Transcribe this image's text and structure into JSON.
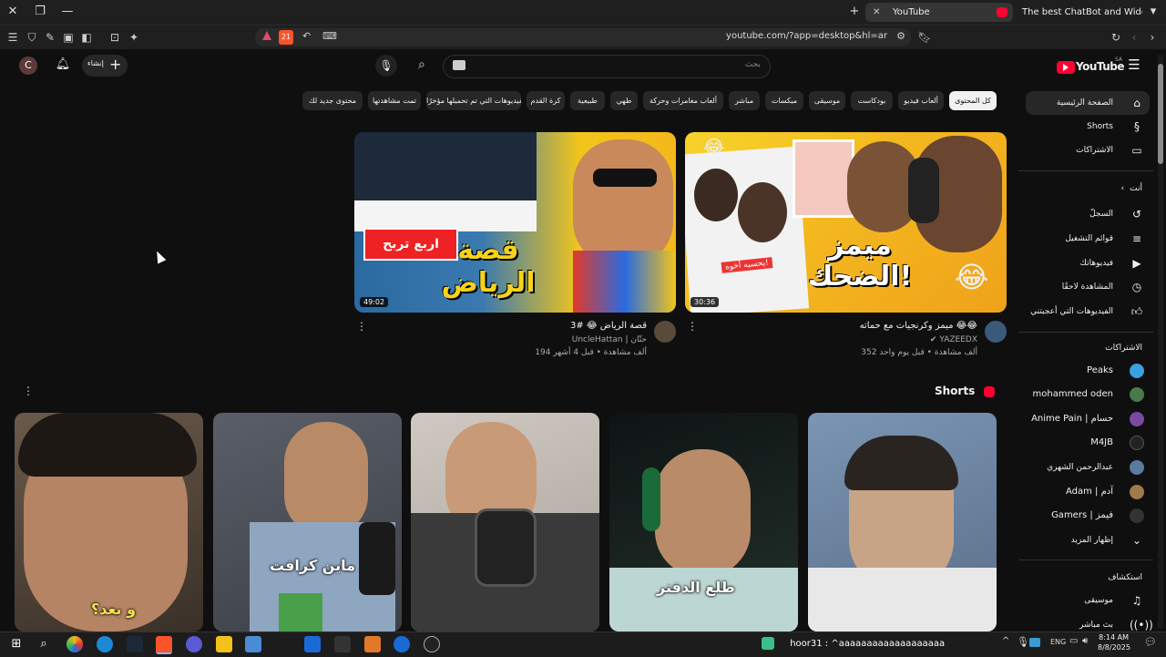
{
  "browser": {
    "tabs": [
      {
        "title": "YouTube"
      },
      {
        "title": "The best ChatBot and Widgets for Ki"
      }
    ],
    "url": "youtube.com/?app=desktop&hl=ar",
    "shield_count": "21"
  },
  "header": {
    "logo_text": "YouTube",
    "logo_region": "SA",
    "search_placeholder": "بحث",
    "create_label": "إنشاء",
    "avatar_letter": "C"
  },
  "chips": [
    "كل المحتوى",
    "ألعاب فيديو",
    "بودكاست",
    "موسيقى",
    "ميكسات",
    "مباشر",
    "ألعاب مغامرات وحركة",
    "طهي",
    "طبيعية",
    "كرة القدم",
    "الفيديوهات التي تم تحميلها مؤخرًا",
    "تمت مشاهدتها",
    "محتوى جديد لك"
  ],
  "sidebar": {
    "main": [
      {
        "label": "الصفحة الرئيسية",
        "icon": "home-icon"
      },
      {
        "label": "Shorts",
        "icon": "shorts-icon"
      },
      {
        "label": "الاشتراكات",
        "icon": "subscriptions-icon"
      }
    ],
    "you_heading": "أنت",
    "you_items": [
      {
        "label": "السجلّ",
        "icon": "history-icon"
      },
      {
        "label": "قوائم التشغيل",
        "icon": "playlists-icon"
      },
      {
        "label": "فيديوهاتك",
        "icon": "your-videos-icon"
      },
      {
        "label": "المشاهدة لاحقًا",
        "icon": "watch-later-icon"
      },
      {
        "label": "الفيديوهات التي أعجبتني",
        "icon": "liked-icon"
      }
    ],
    "subs_heading": "الاشتراكات",
    "subscriptions": [
      {
        "label": "Peaks",
        "color": "#3aa0e0"
      },
      {
        "label": "mohammed oden",
        "color": "#4a7a4a"
      },
      {
        "label": "Anime Pain | حسام",
        "color": "#7a4aa0"
      },
      {
        "label": "M4JB",
        "color": "#222222"
      },
      {
        "label": "عبدالرحمن الشهري",
        "color": "#5a7aa0"
      },
      {
        "label": "Adam | آدم",
        "color": "#a07a4a"
      },
      {
        "label": "Gamers | فيمز",
        "color": "#333333"
      }
    ],
    "show_more": "إظهار المزيد",
    "explore_heading": "استكشاف",
    "explore_items": [
      {
        "label": "موسيقى",
        "icon": "music-icon"
      },
      {
        "label": "بث مباشر",
        "icon": "live-icon"
      }
    ]
  },
  "videos": [
    {
      "title": "ميمز وكرنجيات مع حماته 😂😂",
      "channel": "YAZEEDX",
      "meta": "352 ألف مشاهدة • قبل يوم واحد",
      "duration": "30:36",
      "thumb_big_text": "ميمز الضحك!",
      "thumb_tag": "يحسبه أخوه!"
    },
    {
      "title": "قصة الرياض 😂 #3",
      "channel": "UncleHattan | حتّان",
      "meta": "194 ألف مشاهدة • قبل 4 أشهر",
      "duration": "49:02",
      "thumb_big_text": "قصة الرياض",
      "thumb_tag": "اربع تربح"
    }
  ],
  "shorts": {
    "heading": "Shorts",
    "items": [
      {
        "caption": "",
        "bg": "#6a7f98"
      },
      {
        "caption": "",
        "bg": "#2a2a2a"
      },
      {
        "caption": "طلع الدفتر",
        "bg": "#1d2a2a"
      },
      {
        "caption": "",
        "bg": "#b8b2aa"
      },
      {
        "caption": "ماين كرافت",
        "bg": "#505560"
      },
      {
        "caption": "و بعد؟",
        "bg": "#5a4a40"
      }
    ]
  },
  "taskbar": {
    "ticker": "hoor31 : ^aaaaaaaaaaaaaaaaaaa",
    "lang": "ENG",
    "time": "8:14 AM",
    "date": "8/8/2025"
  }
}
